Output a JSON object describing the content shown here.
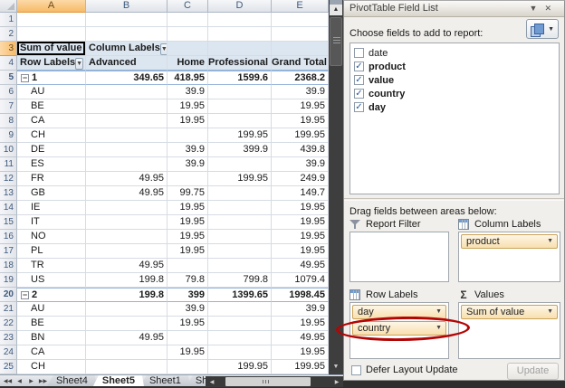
{
  "icons": {
    "dropdown_glyph": "▼",
    "close_glyph": "✕",
    "collapse_glyph": "−",
    "check_glyph": "✓",
    "sigma_glyph": "Σ",
    "nav_first": "◀◀",
    "nav_prev": "◀",
    "nav_next": "▶",
    "nav_last": "▶▶",
    "scroll_up": "▲",
    "scroll_down": "▼",
    "scroll_left": "◀",
    "scroll_right": "▶"
  },
  "colors": {
    "pivot_header_bg": "#DCE6F1",
    "pivot_border": "#95B3D7",
    "selected_header": "#F6BB66",
    "field_button_bg": "#F8DFAE",
    "field_button_border": "#C9A35B",
    "annotation_red": "#B40505"
  },
  "sheet": {
    "columns": [
      "A",
      "B",
      "C",
      "D",
      "E"
    ],
    "active_cell": "A3",
    "pivot": {
      "measure_label": "Sum of value",
      "column_labels_label": "Column Labels",
      "row_labels_label": "Row Labels",
      "column_headers": [
        "Advanced",
        "Home",
        "Professional",
        "Grand Total"
      ]
    },
    "rows": [
      {
        "num": 1,
        "type": "blank"
      },
      {
        "num": 2,
        "type": "blank"
      },
      {
        "num": 3,
        "type": "title"
      },
      {
        "num": 4,
        "type": "colhead"
      },
      {
        "num": 5,
        "type": "subtotal",
        "label": "1",
        "values": [
          "349.65",
          "418.95",
          "1599.6",
          "2368.2"
        ]
      },
      {
        "num": 6,
        "type": "detail",
        "label": "AU",
        "values": [
          "",
          "39.9",
          "",
          "39.9"
        ]
      },
      {
        "num": 7,
        "type": "detail",
        "label": "BE",
        "values": [
          "",
          "19.95",
          "",
          "19.95"
        ]
      },
      {
        "num": 8,
        "type": "detail",
        "label": "CA",
        "values": [
          "",
          "19.95",
          "",
          "19.95"
        ]
      },
      {
        "num": 9,
        "type": "detail",
        "label": "CH",
        "values": [
          "",
          "",
          "199.95",
          "199.95"
        ]
      },
      {
        "num": 10,
        "type": "detail",
        "label": "DE",
        "values": [
          "",
          "39.9",
          "399.9",
          "439.8"
        ]
      },
      {
        "num": 11,
        "type": "detail",
        "label": "ES",
        "values": [
          "",
          "39.9",
          "",
          "39.9"
        ]
      },
      {
        "num": 12,
        "type": "detail",
        "label": "FR",
        "values": [
          "49.95",
          "",
          "199.95",
          "249.9"
        ]
      },
      {
        "num": 13,
        "type": "detail",
        "label": "GB",
        "values": [
          "49.95",
          "99.75",
          "",
          "149.7"
        ]
      },
      {
        "num": 14,
        "type": "detail",
        "label": "IE",
        "values": [
          "",
          "19.95",
          "",
          "19.95"
        ]
      },
      {
        "num": 15,
        "type": "detail",
        "label": "IT",
        "values": [
          "",
          "19.95",
          "",
          "19.95"
        ]
      },
      {
        "num": 16,
        "type": "detail",
        "label": "NO",
        "values": [
          "",
          "19.95",
          "",
          "19.95"
        ]
      },
      {
        "num": 17,
        "type": "detail",
        "label": "PL",
        "values": [
          "",
          "19.95",
          "",
          "19.95"
        ]
      },
      {
        "num": 18,
        "type": "detail",
        "label": "TR",
        "values": [
          "49.95",
          "",
          "",
          "49.95"
        ]
      },
      {
        "num": 19,
        "type": "detail",
        "label": "US",
        "values": [
          "199.8",
          "79.8",
          "799.8",
          "1079.4"
        ]
      },
      {
        "num": 20,
        "type": "subtotal",
        "label": "2",
        "values": [
          "199.8",
          "399",
          "1399.65",
          "1998.45"
        ]
      },
      {
        "num": 21,
        "type": "detail",
        "label": "AU",
        "values": [
          "",
          "39.9",
          "",
          "39.9"
        ]
      },
      {
        "num": 22,
        "type": "detail",
        "label": "BE",
        "values": [
          "",
          "19.95",
          "",
          "19.95"
        ]
      },
      {
        "num": 23,
        "type": "detail",
        "label": "BN",
        "values": [
          "49.95",
          "",
          "",
          "49.95"
        ]
      },
      {
        "num": 24,
        "type": "detail",
        "label": "CA",
        "values": [
          "",
          "19.95",
          "",
          "19.95"
        ]
      },
      {
        "num": 25,
        "type": "detail",
        "label": "CH",
        "values": [
          "",
          "",
          "199.95",
          "199.95"
        ]
      }
    ]
  },
  "tabbar": {
    "tabs": [
      {
        "label": "Sheet4",
        "active": false
      },
      {
        "label": "Sheet5",
        "active": true
      },
      {
        "label": "Sheet1",
        "active": false
      },
      {
        "label": "She",
        "active": false,
        "clipped": true
      }
    ]
  },
  "pane": {
    "title": "PivotTable Field List",
    "choose_label": "Choose fields to add to report:",
    "fields": [
      {
        "name": "date",
        "checked": false
      },
      {
        "name": "product",
        "checked": true
      },
      {
        "name": "value",
        "checked": true
      },
      {
        "name": "country",
        "checked": true
      },
      {
        "name": "day",
        "checked": true
      }
    ],
    "drag_label": "Drag fields between areas below:",
    "areas": {
      "report_filter": {
        "label": "Report Filter",
        "items": []
      },
      "column_labels": {
        "label": "Column Labels",
        "items": [
          "product"
        ]
      },
      "row_labels": {
        "label": "Row Labels",
        "items": [
          "day",
          "country"
        ]
      },
      "values": {
        "label": "Values",
        "items": [
          "Sum of value"
        ]
      }
    },
    "defer_label": "Defer Layout Update",
    "defer_checked": false,
    "update_label": "Update"
  }
}
